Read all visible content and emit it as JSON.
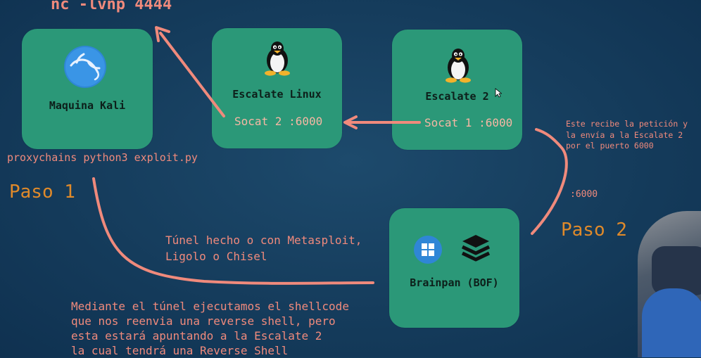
{
  "command": "nc -lvnp 4444",
  "nodes": {
    "kali": {
      "label": "Maquina Kali",
      "below_text": "proxychains python3 exploit.py"
    },
    "escalate_linux": {
      "label": "Escalate Linux",
      "socat": "Socat 2 :6000"
    },
    "escalate2": {
      "label": "Escalate 2",
      "socat": "Socat 1 :6000"
    },
    "brainpan": {
      "label": "Brainpan (BOF)"
    }
  },
  "paso1": "Paso 1",
  "paso2": "Paso 2",
  "port_label": ":6000",
  "note_escalate": [
    "Este recibe la petición y",
    "la envía a la Escalate 2",
    "por el puerto 6000"
  ],
  "tunnel_text": [
    "Túnel hecho o con Metasploit,",
    "Ligolo o Chisel"
  ],
  "bottom_text": [
    "Mediante el túnel ejecutamos el shellcode",
    "que nos reenvia una reverse shell, pero",
    "esta estará apuntando a la Escalate 2",
    "la cual tendrá una Reverse Shell"
  ],
  "colors": {
    "node": "#2b9878",
    "arrow": "#f08a7c",
    "background": "#163f5f"
  },
  "icons": [
    "kali-dragon-icon",
    "tux-icon",
    "windows-icon",
    "stack-layers-icon",
    "mouse-cursor-icon"
  ]
}
